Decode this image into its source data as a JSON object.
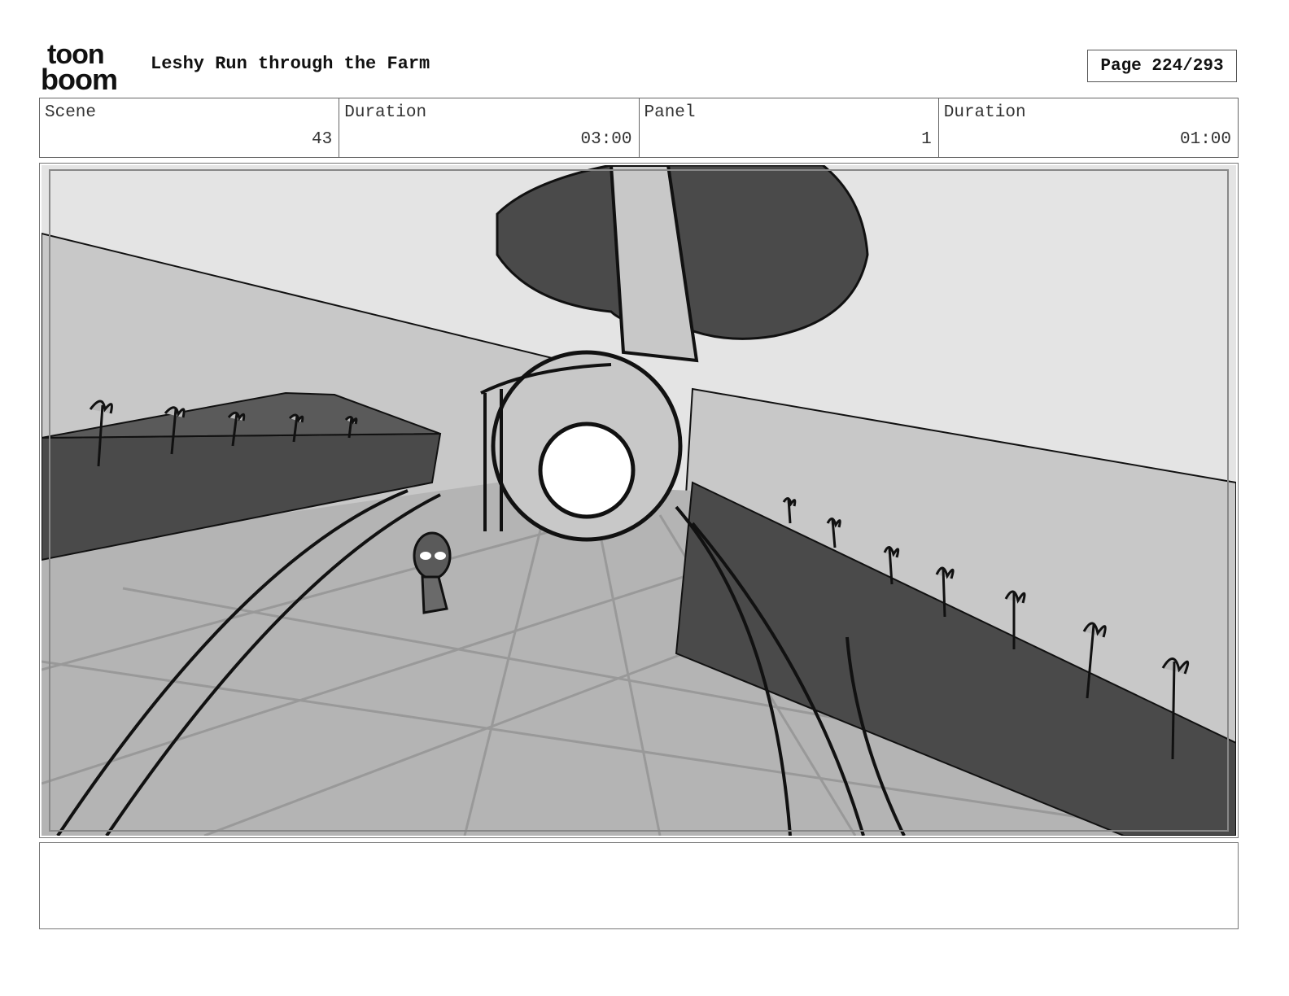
{
  "header": {
    "logo_top": "toon",
    "logo_bottom": "boom",
    "title": "Leshy Run through the Farm",
    "page": "Page 224/293"
  },
  "info": {
    "scene_label": "Scene",
    "scene_value": "43",
    "scene_duration_label": "Duration",
    "scene_duration_value": "03:00",
    "panel_label": "Panel",
    "panel_value": "1",
    "panel_duration_label": "Duration",
    "panel_duration_value": "01:00"
  },
  "colors": {
    "sky": "#e4e4e4",
    "wall": "#c8c8c8",
    "ground": "#b4b4b4",
    "dark": "#4a4a4a",
    "ink": "#111111"
  },
  "notes": {
    "text": ""
  }
}
